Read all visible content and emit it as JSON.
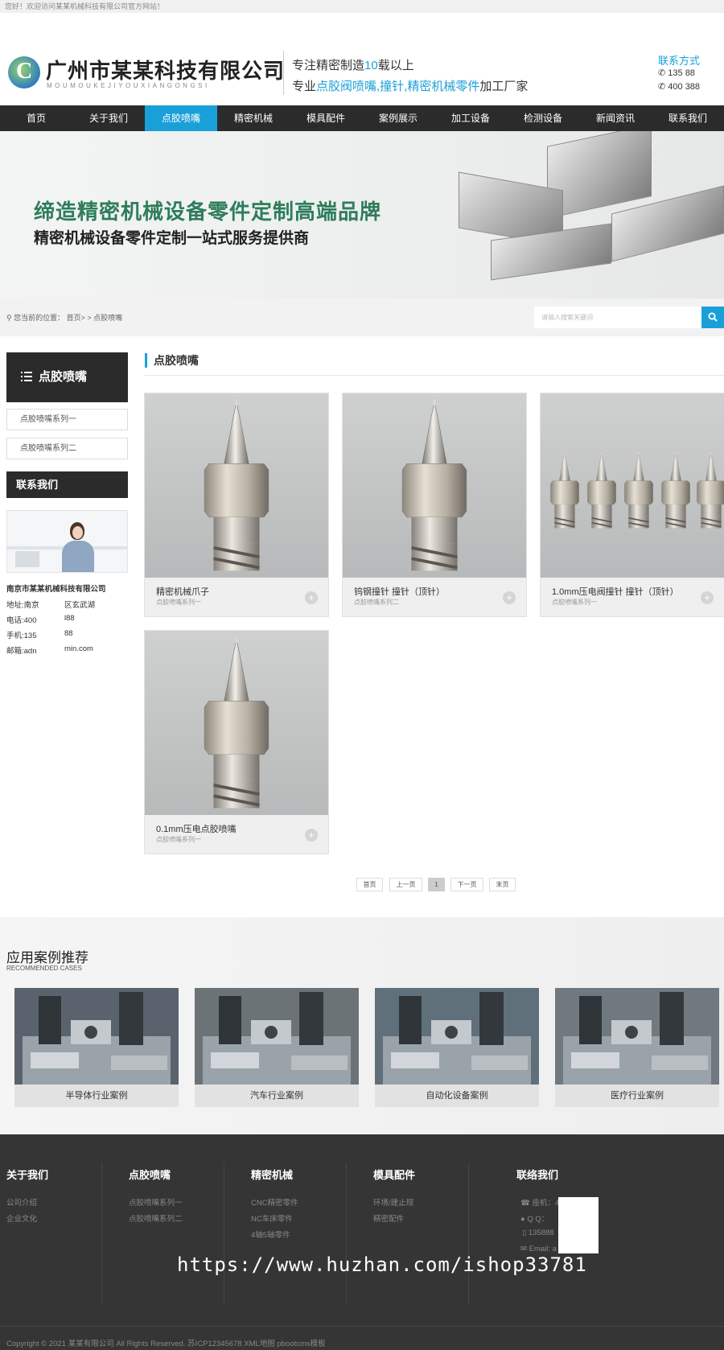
{
  "topbar": {
    "welcome": "您好！欢迎访问某某机械科技有限公司官方网站！"
  },
  "header": {
    "company": "广州市某某科技有限公司",
    "company_pinyin": "MOUMOUKEJIYOUXIANGONGSI",
    "slogan1_pre": "专注精密制造",
    "slogan1_num": "10",
    "slogan1_post": "载以上",
    "slogan2_pre": "专业",
    "slogan2_hl": "点胶阀喷嘴,撞针,精密机械零件",
    "slogan2_post": "加工厂家",
    "contact_title": "联系方式",
    "phone1": "135          88",
    "phone2": "400          388"
  },
  "nav": [
    {
      "label": "首页",
      "active": false
    },
    {
      "label": "关于我们",
      "active": false
    },
    {
      "label": "点胶喷嘴",
      "active": true
    },
    {
      "label": "精密机械",
      "active": false
    },
    {
      "label": "模具配件",
      "active": false
    },
    {
      "label": "案例展示",
      "active": false
    },
    {
      "label": "加工设备",
      "active": false
    },
    {
      "label": "检测设备",
      "active": false
    },
    {
      "label": "新闻资讯",
      "active": false
    },
    {
      "label": "联系我们",
      "active": false
    }
  ],
  "banner": {
    "title": "缔造精密机械设备零件定制高端品牌",
    "subtitle": "精密机械设备零件定制一站式服务提供商"
  },
  "location": {
    "text": "您当前的位置： 首页> > 点胶喷嘴",
    "search_placeholder": "请输入搜索关键词"
  },
  "sidebar": {
    "title": "点胶喷嘴",
    "items": [
      "点胶喷嘴系列一",
      "点胶喷嘴系列二"
    ],
    "contact_title": "联系我们",
    "company": "南京市某某机械科技有限公司",
    "address_label": "地址:南京",
    "address_value": "区玄武湖",
    "tel_label": "电话:400",
    "tel_value": "l88",
    "mobile_label": "手机:135",
    "mobile_value": "88",
    "email_label": "邮箱:adn",
    "email_value": "min.com"
  },
  "section": {
    "title": "点胶喷嘴"
  },
  "products": [
    {
      "title": "精密机械爪子",
      "category": "点胶喷嘴系列一",
      "kind": "single"
    },
    {
      "title": "钨钢撞针 撞针（顶针）",
      "category": "点胶喷嘴系列二",
      "kind": "single"
    },
    {
      "title": "1.0mm压电阀撞针 撞针（顶针）",
      "category": "点胶喷嘴系列一",
      "kind": "row"
    },
    {
      "title": "0.1mm压电点胶喷嘴",
      "category": "点胶喷嘴系列一",
      "kind": "single"
    }
  ],
  "pagination": {
    "first": "首页",
    "prev": "上一页",
    "current": "1",
    "next": "下一页",
    "last": "末页"
  },
  "cases": {
    "title": "应用案例推荐",
    "subtitle": "RECOMMENDED CASES",
    "items": [
      "半导体行业案例",
      "汽车行业案例",
      "自动化设备案例",
      "医疗行业案例"
    ]
  },
  "footer": {
    "cols": [
      {
        "title": "关于我们",
        "links": [
          "公司介绍",
          "企业文化"
        ]
      },
      {
        "title": "点胶喷嘴",
        "links": [
          "点胶喷嘴系列一",
          "点胶喷嘴系列二"
        ]
      },
      {
        "title": "精密机械",
        "links": [
          "CNC精密零件",
          "NC车床零件",
          "4轴5轴零件"
        ]
      },
      {
        "title": "模具配件",
        "links": [
          "环境/建止规",
          "精密配件"
        ]
      }
    ],
    "contact_title": "联络我们",
    "contact": [
      "座机：400         l88",
      "Q Q：",
      "135888",
      "Email: a              min.com"
    ],
    "copyright": "Copyright © 2021 某某有限公司 All Rights Reserved. 苏ICP12345678 XML地图 pbootcms模板"
  },
  "watermark": "https://www.huzhan.com/ishop33781",
  "colors": {
    "accent": "#1aa0d8",
    "dark": "#2b2b2b",
    "footer": "#353535",
    "banner_green": "#2e7d5b"
  }
}
